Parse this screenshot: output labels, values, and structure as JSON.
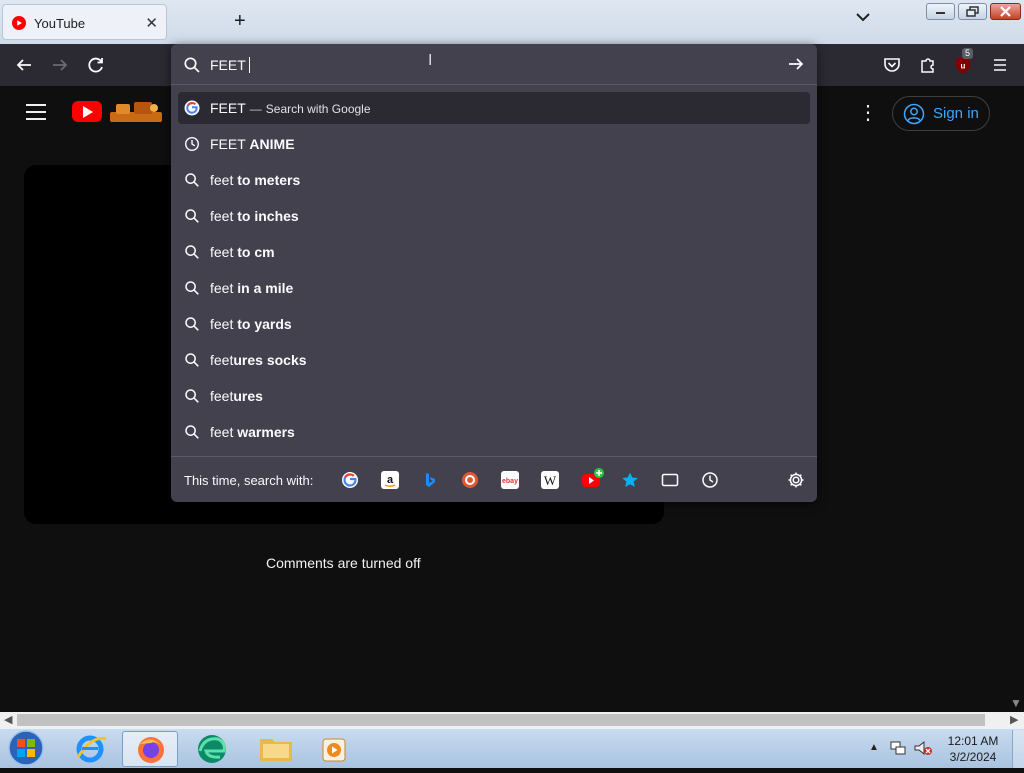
{
  "browser": {
    "tab": {
      "title": "YouTube"
    },
    "new_tab_label": "+",
    "tab_list_label": "⌄",
    "toolbar": {
      "extensions_badge": "5"
    }
  },
  "address_bar": {
    "value": "FEET",
    "suggestions": [
      {
        "icon": "google-icon",
        "prefix": "FEET",
        "bold": "",
        "sep": "—",
        "sub": "Search with Google",
        "selected": true
      },
      {
        "icon": "history-icon",
        "prefix": "FEET ",
        "bold": "ANIME"
      },
      {
        "icon": "search-icon",
        "prefix": "feet ",
        "bold": "to meters"
      },
      {
        "icon": "search-icon",
        "prefix": "feet ",
        "bold": "to inches"
      },
      {
        "icon": "search-icon",
        "prefix": "feet ",
        "bold": "to cm"
      },
      {
        "icon": "search-icon",
        "prefix": "feet ",
        "bold": "in a mile"
      },
      {
        "icon": "search-icon",
        "prefix": "feet ",
        "bold": "to yards"
      },
      {
        "icon": "search-icon",
        "prefix": "feet",
        "bold": "ures socks"
      },
      {
        "icon": "search-icon",
        "prefix": "feet",
        "bold": "ures"
      },
      {
        "icon": "search-icon",
        "prefix": "feet ",
        "bold": "warmers"
      }
    ],
    "oneoff_label": "This time, search with:",
    "engines": [
      "google-icon",
      "amazon-icon",
      "bing-icon",
      "duckduckgo-icon",
      "ebay-icon",
      "wikipedia-icon",
      "youtube-add-icon",
      "bookmarks-icon",
      "tabs-icon",
      "history-icon"
    ]
  },
  "youtube": {
    "sign_in_label": "Sign in",
    "comments_off": "Comments are turned off"
  },
  "taskbar": {
    "time": "12:01 AM",
    "date": "3/2/2024"
  },
  "colors": {
    "toolbar_bg": "#2b2a33",
    "panel_bg": "#42414d",
    "youtube_red": "#ff0000",
    "link_blue": "#3ea6ff"
  }
}
